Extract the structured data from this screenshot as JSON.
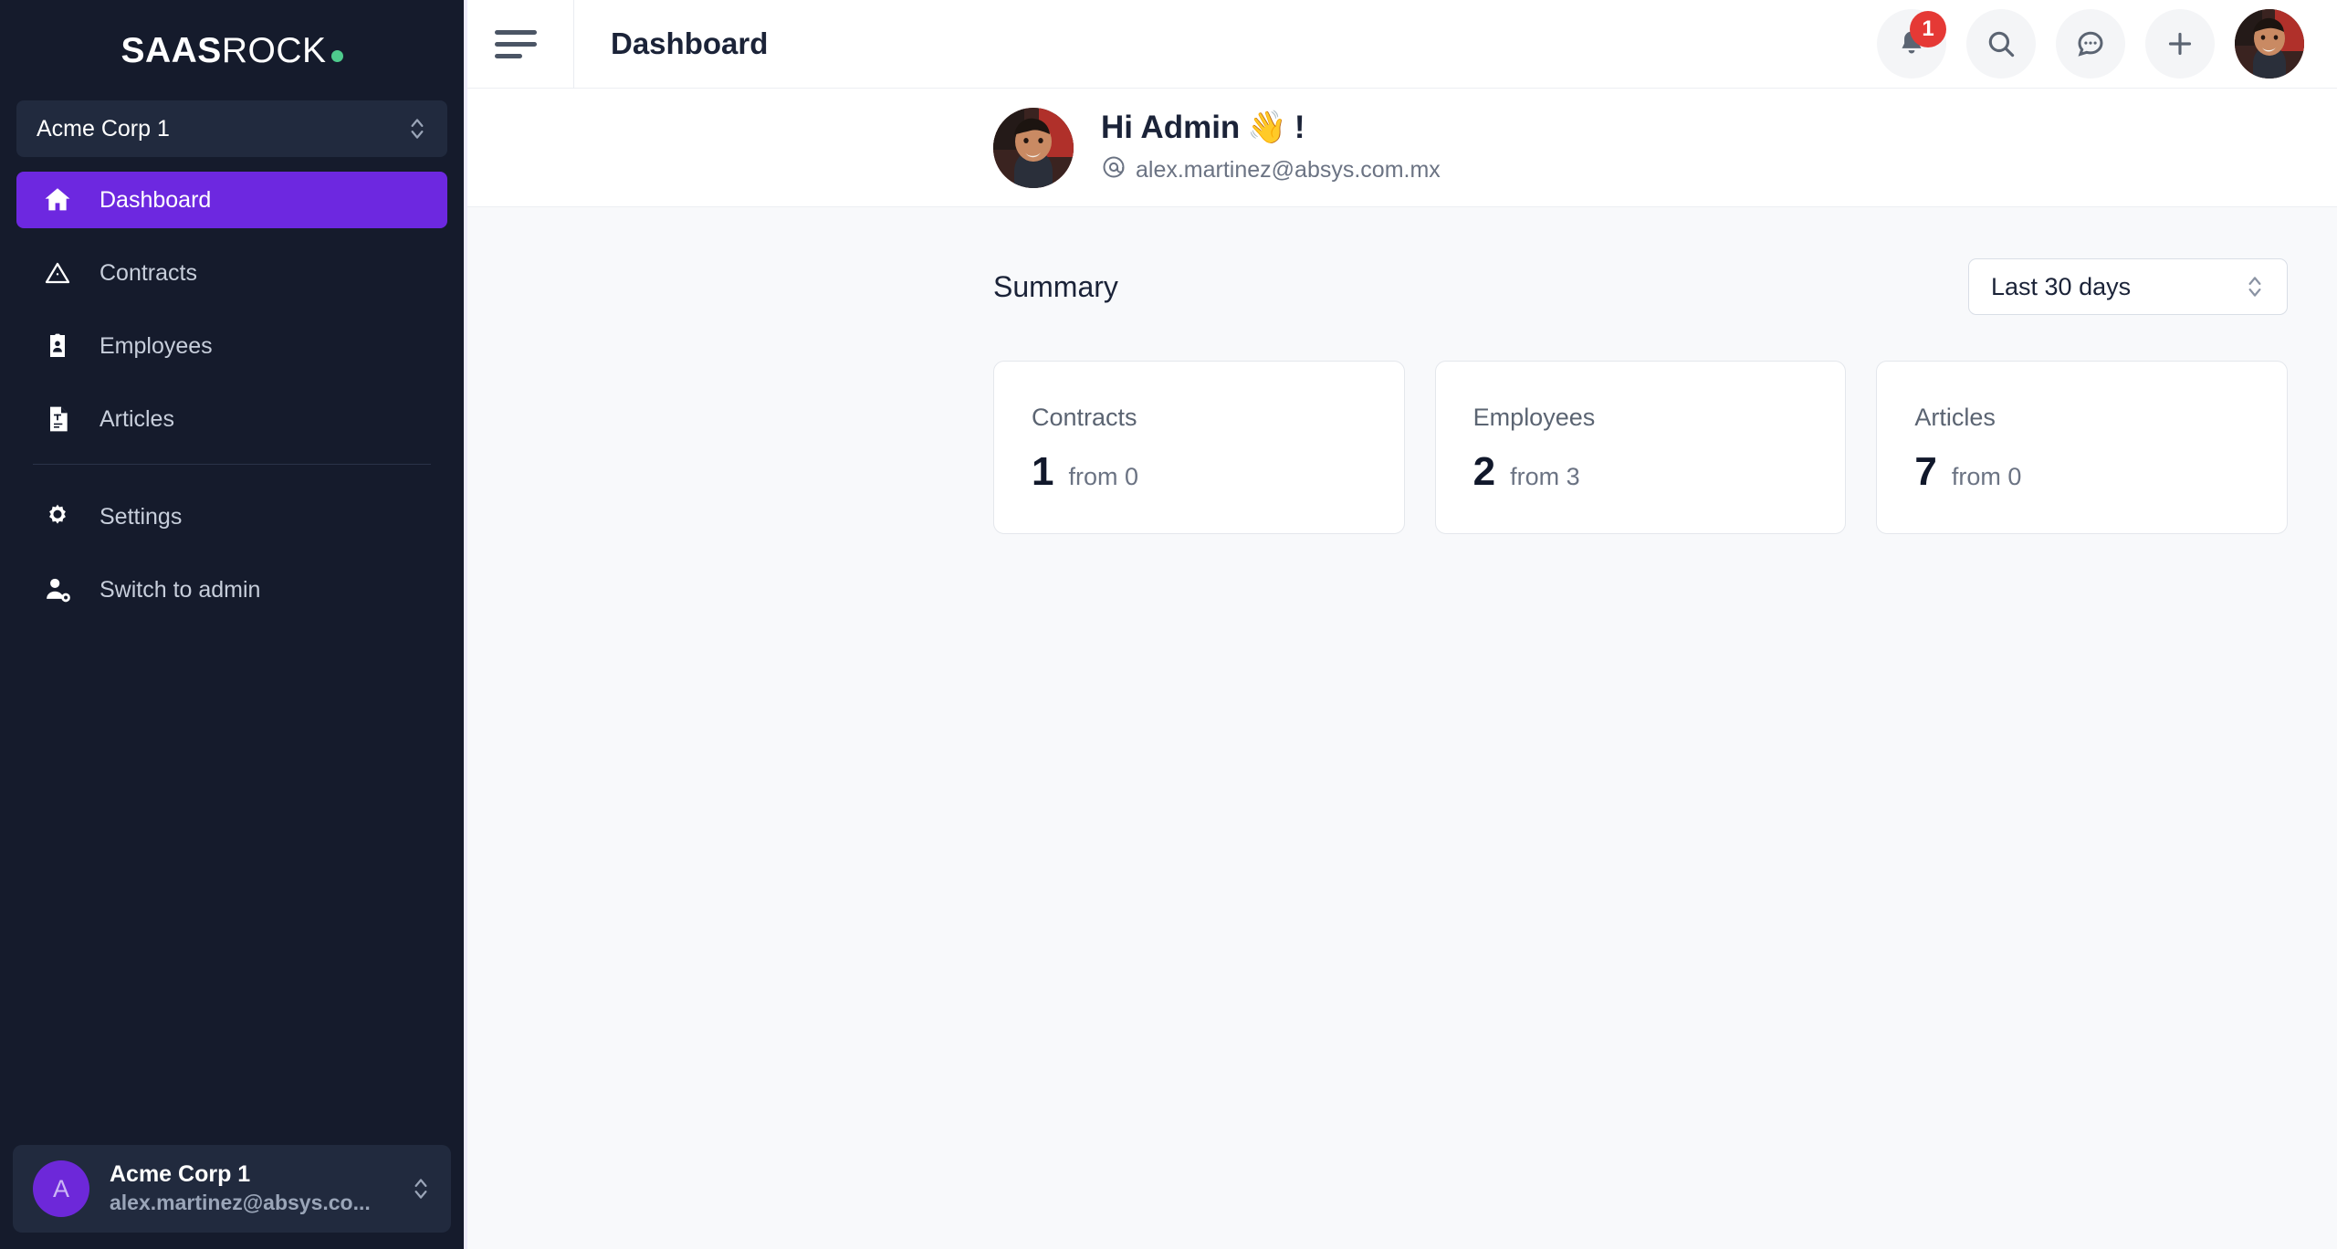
{
  "brand": {
    "bold_part": "SAAS",
    "light_part": "ROCK",
    "dot_color": "#4ECB8D"
  },
  "sidebar": {
    "org_selector": {
      "name": "Acme Corp 1",
      "icon": "chevron-updown-icon"
    },
    "items": [
      {
        "label": "Dashboard",
        "icon": "home-icon",
        "active": true
      },
      {
        "label": "Contracts",
        "icon": "triangle-alert-icon",
        "active": false
      },
      {
        "label": "Employees",
        "icon": "id-badge-icon",
        "active": false
      },
      {
        "label": "Articles",
        "icon": "document-text-icon",
        "active": false
      }
    ],
    "secondary_items": [
      {
        "label": "Settings",
        "icon": "gear-icon"
      },
      {
        "label": "Switch to admin",
        "icon": "user-cog-icon"
      }
    ],
    "user_card": {
      "avatar_initial": "A",
      "name": "Acme Corp 1",
      "email": "alex.martinez@absys.co...",
      "icon": "chevron-updown-icon"
    },
    "active_color": "#6D28E0",
    "background_color": "#151B2C"
  },
  "topbar": {
    "menu_icon": "hamburger-icon",
    "title": "Dashboard",
    "actions": [
      {
        "name": "notifications",
        "icon": "bell-icon",
        "badge": "1",
        "badge_color": "#E53935"
      },
      {
        "name": "search",
        "icon": "search-icon",
        "badge": null
      },
      {
        "name": "messages",
        "icon": "chat-bubble-icon",
        "badge": null
      },
      {
        "name": "add",
        "icon": "plus-icon",
        "badge": null
      }
    ],
    "avatar": "user-photo"
  },
  "greeting": {
    "heading": "Hi Admin",
    "wave_emoji": "👋",
    "exclamation": "!",
    "at_icon": "at-sign-icon",
    "email": "alex.martinez@absys.com.mx"
  },
  "summary": {
    "title": "Summary",
    "range": {
      "selected": "Last 30 days",
      "icon": "chevron-updown-icon"
    },
    "cards": [
      {
        "label": "Contracts",
        "value": "1",
        "from_text": "from 0"
      },
      {
        "label": "Employees",
        "value": "2",
        "from_text": "from 3"
      },
      {
        "label": "Articles",
        "value": "7",
        "from_text": "from 0"
      }
    ]
  }
}
